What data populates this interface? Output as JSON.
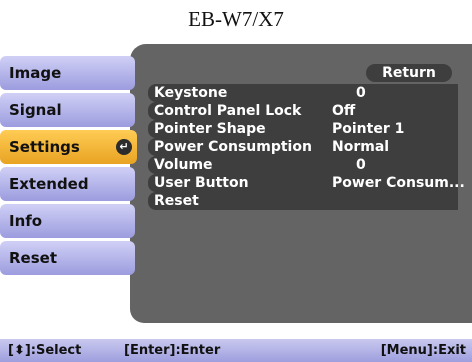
{
  "model_title": "EB-W7/X7",
  "tabs": [
    {
      "label": "Image"
    },
    {
      "label": "Signal"
    },
    {
      "label": "Settings",
      "active": true
    },
    {
      "label": "Extended"
    },
    {
      "label": "Info"
    },
    {
      "label": "Reset"
    }
  ],
  "enter_icon": "enter-icon",
  "return_label": "Return",
  "settings": [
    {
      "label": "Keystone",
      "value": "0"
    },
    {
      "label": "Control Panel Lock",
      "value": "Off"
    },
    {
      "label": "Pointer Shape",
      "value": "Pointer 1"
    },
    {
      "label": "Power Consumption",
      "value": "Normal"
    },
    {
      "label": "Volume",
      "value": "0"
    },
    {
      "label": "User Button",
      "value": "Power Consum..."
    },
    {
      "label": "Reset",
      "value": ""
    }
  ],
  "statusbar": {
    "select": "[⬍]:Select",
    "enter": "[Enter]:Enter",
    "exit": "[Menu]:Exit"
  },
  "colors": {
    "active_tab": "#f2b33c",
    "inactive_tab": "#b6b6ec",
    "panel": "#646464"
  }
}
